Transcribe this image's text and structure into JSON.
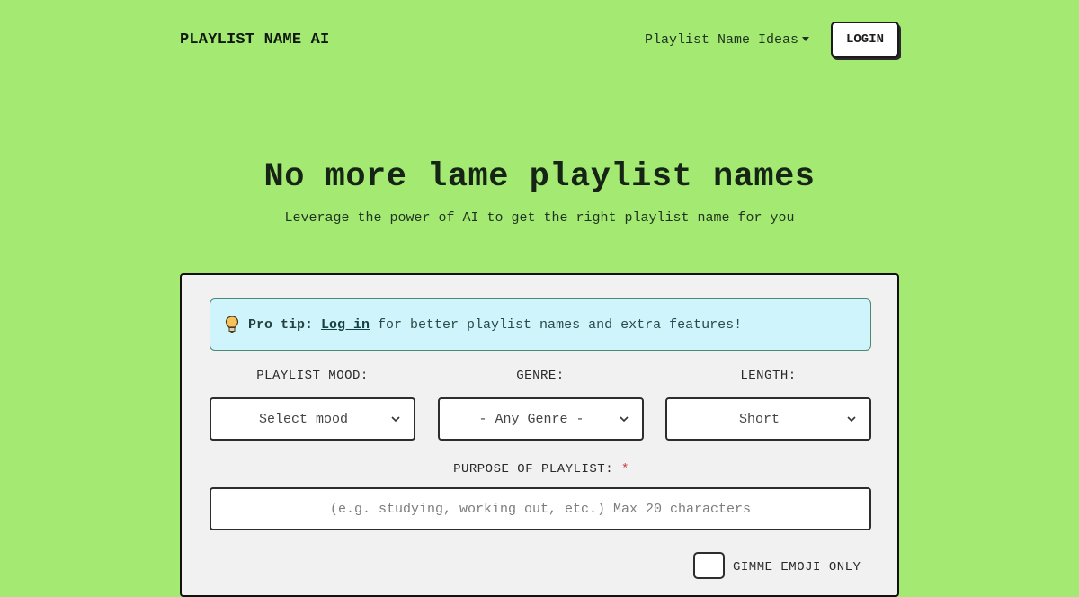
{
  "nav": {
    "brand": "PLAYLIST NAME AI",
    "ideas_link": "Playlist Name Ideas",
    "login_button": "LOGIN"
  },
  "hero": {
    "title": "No more lame playlist names",
    "subtitle": "Leverage the power of AI to get the right playlist name for you"
  },
  "form": {
    "tip": {
      "icon": "lightbulb-icon",
      "prefix": "Pro tip:",
      "link": "Log in",
      "text": "for better playlist names and extra features!"
    },
    "mood": {
      "label": "PLAYLIST MOOD:",
      "value": "Select mood"
    },
    "genre": {
      "label": "GENRE:",
      "value": "- Any Genre -"
    },
    "length": {
      "label": "LENGTH:",
      "value": "Short"
    },
    "purpose": {
      "label": "PURPOSE OF PLAYLIST:",
      "required_mark": "*",
      "placeholder": "(e.g. studying, working out, etc.) Max 20 characters",
      "value": ""
    },
    "emoji_only": {
      "label": "GIMME EMOJI ONLY",
      "checked": false
    }
  },
  "colors": {
    "background": "#a3e972",
    "card": "#f1f1f1",
    "tip_bg": "#cff4fb",
    "required": "#c43b3b"
  }
}
